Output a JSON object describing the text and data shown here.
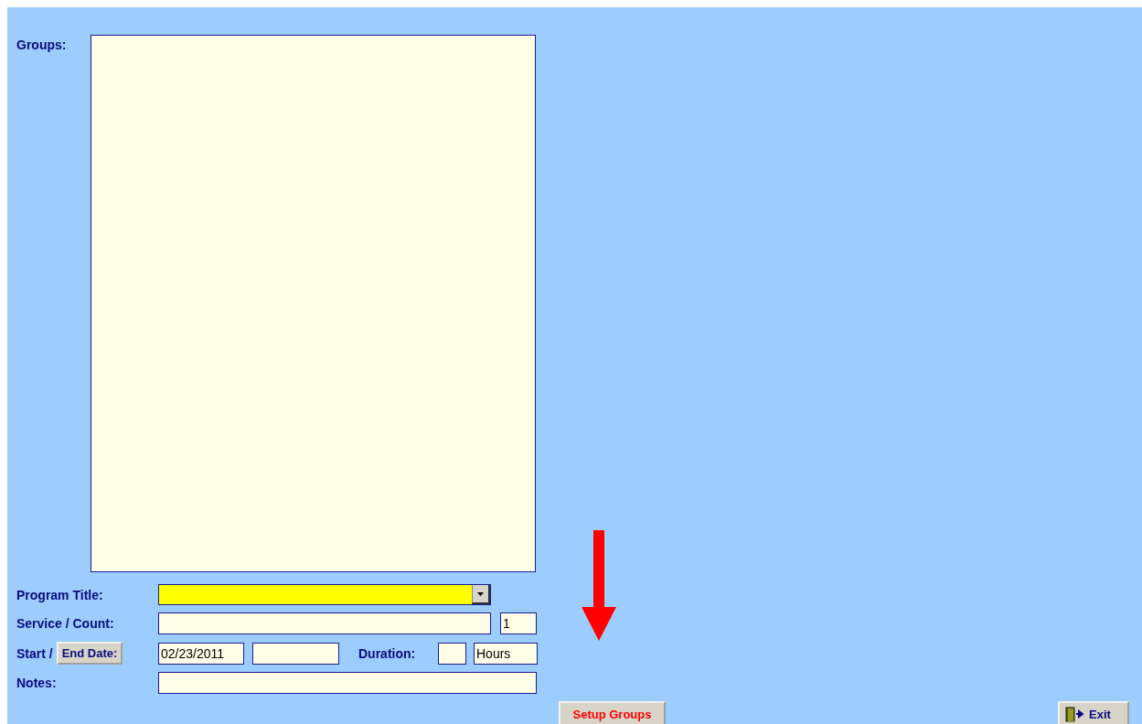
{
  "groups": {
    "label": "Groups:"
  },
  "program_title": {
    "label": "Program Title:"
  },
  "service_count": {
    "label": "Service / Count:",
    "count": "1"
  },
  "dates": {
    "label": "Start /",
    "end_date_button": "End Date:",
    "start_date": "02/23/2011"
  },
  "duration": {
    "label": "Duration:",
    "unit": "Hours"
  },
  "notes": {
    "label": "Notes:"
  },
  "buttons": [
    {
      "label": "Setup Groups",
      "kind": "setup"
    },
    {
      "label": "Exit",
      "kind": "exit"
    }
  ]
}
